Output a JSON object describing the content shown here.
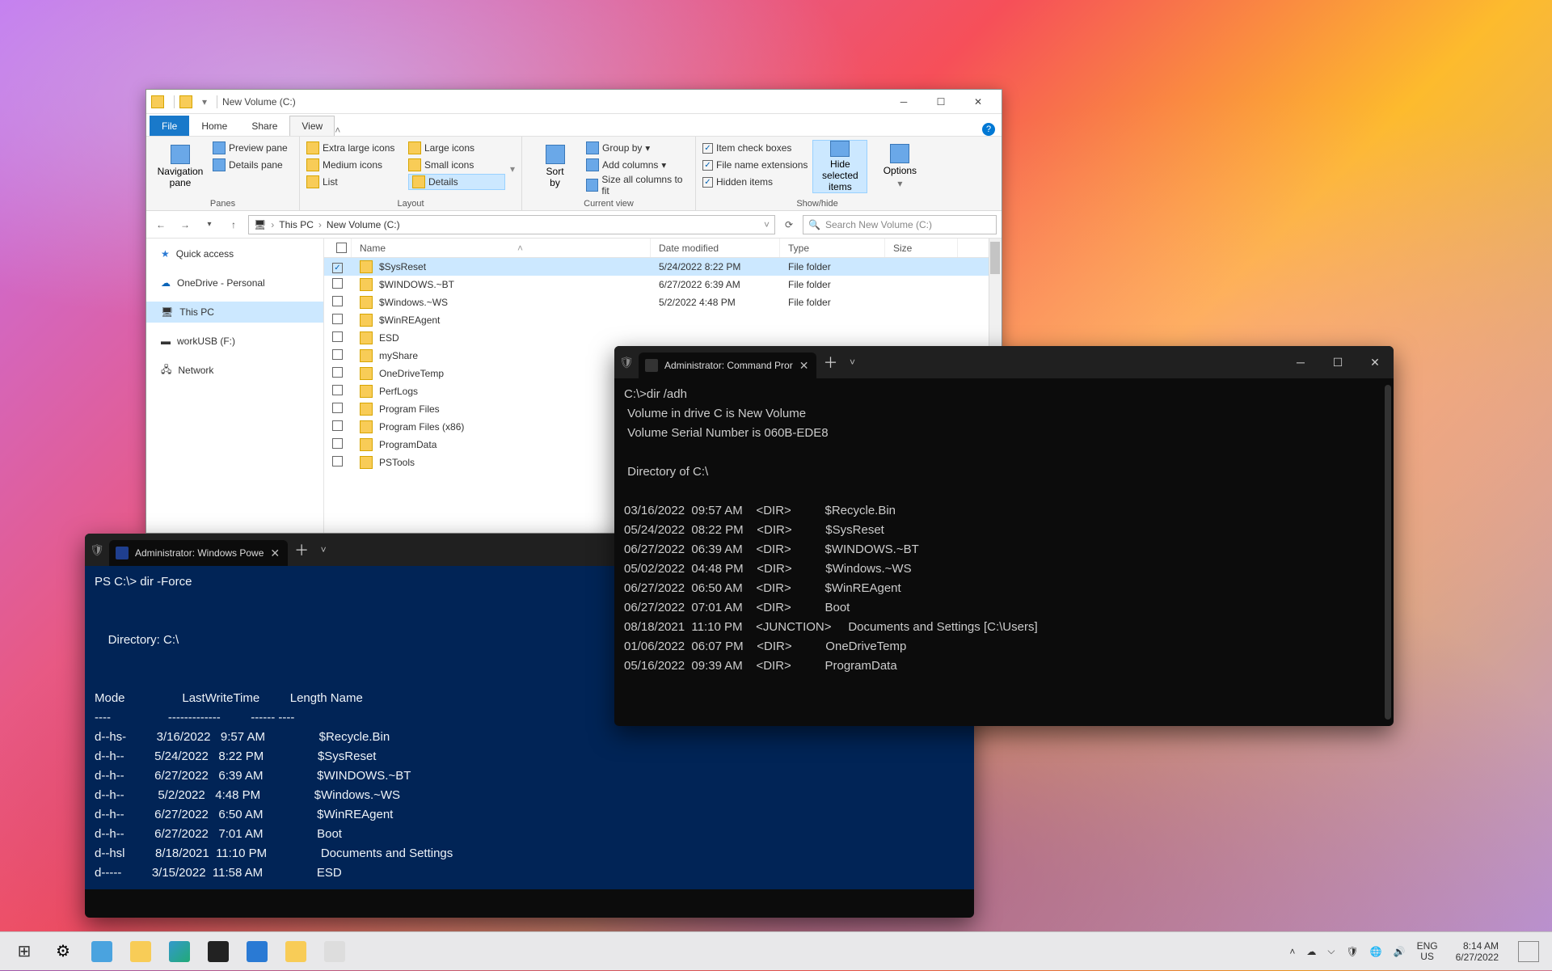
{
  "explorer": {
    "title": "New Volume (C:)",
    "tabs": {
      "file": "File",
      "home": "Home",
      "share": "Share",
      "view": "View"
    },
    "ribbon": {
      "panes": {
        "nav": "Navigation\npane",
        "preview": "Preview pane",
        "details": "Details pane",
        "label": "Panes"
      },
      "layout": {
        "xl": "Extra large icons",
        "l": "Large icons",
        "m": "Medium icons",
        "s": "Small icons",
        "list": "List",
        "details": "Details",
        "label": "Layout"
      },
      "current": {
        "sort": "Sort\nby",
        "group": "Group by",
        "addcols": "Add columns",
        "sizeall": "Size all columns to fit",
        "label": "Current view"
      },
      "show": {
        "item": "Item check boxes",
        "ext": "File name extensions",
        "hidden": "Hidden items",
        "hide": "Hide selected\nitems",
        "options": "Options",
        "label": "Show/hide"
      }
    },
    "breadcrumb": {
      "thispc": "This PC",
      "vol": "New Volume (C:)"
    },
    "search_placeholder": "Search New Volume (C:)",
    "nav": {
      "quick": "Quick access",
      "onedrive": "OneDrive - Personal",
      "thispc": "This PC",
      "workusb": "workUSB (F:)",
      "network": "Network"
    },
    "cols": {
      "name": "Name",
      "date": "Date modified",
      "type": "Type",
      "size": "Size"
    },
    "rows": [
      {
        "name": "$SysReset",
        "date": "5/24/2022 8:22 PM",
        "type": "File folder",
        "sel": true
      },
      {
        "name": "$WINDOWS.~BT",
        "date": "6/27/2022 6:39 AM",
        "type": "File folder"
      },
      {
        "name": "$Windows.~WS",
        "date": "5/2/2022 4:48 PM",
        "type": "File folder"
      },
      {
        "name": "$WinREAgent",
        "date": "",
        "type": ""
      },
      {
        "name": "ESD",
        "date": "",
        "type": ""
      },
      {
        "name": "myShare",
        "date": "",
        "type": ""
      },
      {
        "name": "OneDriveTemp",
        "date": "",
        "type": ""
      },
      {
        "name": "PerfLogs",
        "date": "",
        "type": ""
      },
      {
        "name": "Program Files",
        "date": "",
        "type": ""
      },
      {
        "name": "Program Files (x86)",
        "date": "",
        "type": ""
      },
      {
        "name": "ProgramData",
        "date": "",
        "type": ""
      },
      {
        "name": "PSTools",
        "date": "",
        "type": ""
      }
    ]
  },
  "ps": {
    "tab": "Administrator: Windows Powe",
    "output": "PS C:\\> dir -Force\n\n\n    Directory: C:\\\n\n\nMode                 LastWriteTime         Length Name\n----                 -------------         ------ ----\nd--hs-         3/16/2022   9:57 AM                $Recycle.Bin\nd--h--         5/24/2022   8:22 PM                $SysReset\nd--h--         6/27/2022   6:39 AM                $WINDOWS.~BT\nd--h--          5/2/2022   4:48 PM                $Windows.~WS\nd--h--         6/27/2022   6:50 AM                $WinREAgent\nd--h--         6/27/2022   7:01 AM                Boot\nd--hsl         8/18/2021  11:10 PM                Documents and Settings\nd-----         3/15/2022  11:58 AM                ESD"
  },
  "cmd": {
    "tab": "Administrator: Command Pror",
    "output": "C:\\>dir /adh\n Volume in drive C is New Volume\n Volume Serial Number is 060B-EDE8\n\n Directory of C:\\\n\n03/16/2022  09:57 AM    <DIR>          $Recycle.Bin\n05/24/2022  08:22 PM    <DIR>          $SysReset\n06/27/2022  06:39 AM    <DIR>          $WINDOWS.~BT\n05/02/2022  04:48 PM    <DIR>          $Windows.~WS\n06/27/2022  06:50 AM    <DIR>          $WinREAgent\n06/27/2022  07:01 AM    <DIR>          Boot\n08/18/2021  11:10 PM    <JUNCTION>     Documents and Settings [C:\\Users]\n01/06/2022  06:07 PM    <DIR>          OneDriveTemp\n05/16/2022  09:39 AM    <DIR>          ProgramData"
  },
  "tray": {
    "lang1": "ENG",
    "lang2": "US",
    "time": "8:14 AM",
    "date": "6/27/2022"
  }
}
